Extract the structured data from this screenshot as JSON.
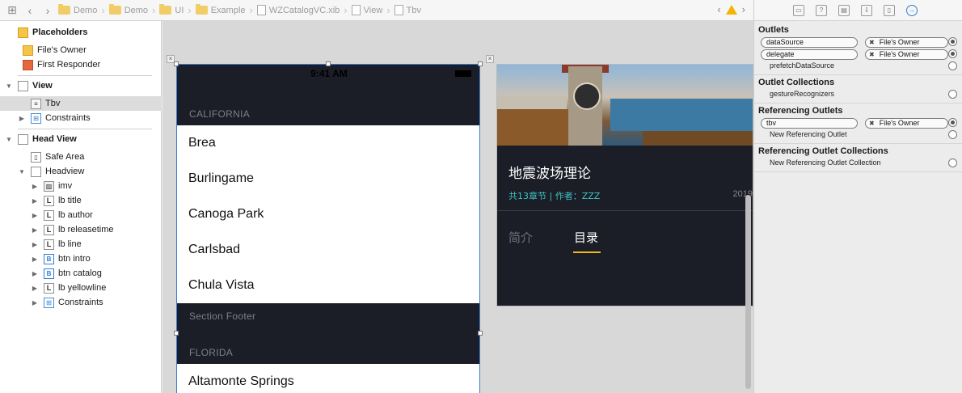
{
  "jumpbar": {
    "crumbs": [
      "Demo",
      "Demo",
      "UI",
      "Example",
      "WZCatalogVC.xib",
      "View",
      "Tbv"
    ]
  },
  "outline": {
    "placeholders": "Placeholders",
    "files_owner": "File's Owner",
    "first_responder": "First Responder",
    "view": "View",
    "tbv": "Tbv",
    "constraints": "Constraints",
    "head_view": "Head View",
    "safe_area": "Safe Area",
    "headview": "Headview",
    "children": [
      "imv",
      "lb title",
      "lb author",
      "lb releasetime",
      "lb line",
      "btn intro",
      "btn catalog",
      "lb yellowline",
      "Constraints"
    ],
    "child_icons": [
      "imv",
      "L",
      "L",
      "L",
      "L",
      "B",
      "B",
      "L",
      "C"
    ]
  },
  "scene1": {
    "time": "9:41 AM",
    "section1": "CALIFORNIA",
    "cells1": [
      "Brea",
      "Burlingame",
      "Canoga Park",
      "Carlsbad",
      "Chula Vista"
    ],
    "footer": "Section Footer",
    "section2": "FLORIDA",
    "cells2": [
      "Altamonte Springs"
    ]
  },
  "scene2": {
    "title": "地震波场理论",
    "meta": "共13章节   |   作者：ZZZ",
    "year": "2019",
    "tab_intro": "简介",
    "tab_catalog": "目录"
  },
  "inspector": {
    "outlets_title": "Outlets",
    "outlets": [
      {
        "name": "dataSource",
        "target": "File's Owner",
        "connected": true
      },
      {
        "name": "delegate",
        "target": "File's Owner",
        "connected": true
      },
      {
        "name": "prefetchDataSource",
        "target": "",
        "connected": false
      }
    ],
    "collections_title": "Outlet Collections",
    "collections": [
      {
        "name": "gestureRecognizers"
      }
    ],
    "referencing_title": "Referencing Outlets",
    "referencing": [
      {
        "name": "tbv",
        "target": "File's Owner",
        "connected": true
      },
      {
        "name": "New Referencing Outlet",
        "target": "",
        "connected": false
      }
    ],
    "ref_collections_title": "Referencing Outlet Collections",
    "ref_collections": [
      {
        "name": "New Referencing Outlet Collection"
      }
    ]
  }
}
